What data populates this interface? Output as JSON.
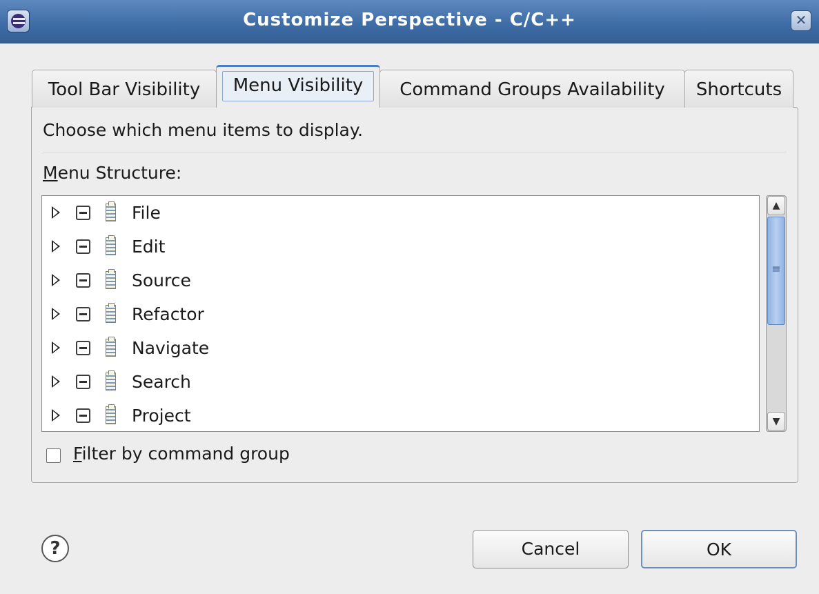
{
  "window": {
    "title": "Customize Perspective - C/C++",
    "close_glyph": "✕"
  },
  "tabs": [
    {
      "label": "Tool Bar Visibility",
      "active": false
    },
    {
      "label": "Menu Visibility",
      "active": true
    },
    {
      "label": "Command Groups Availability",
      "active": false
    },
    {
      "label": "Shortcuts",
      "active": false
    }
  ],
  "panel": {
    "description": "Choose which menu items to display.",
    "menu_structure_mnemonic": "M",
    "menu_structure_rest": "enu Structure:",
    "tree_items": [
      {
        "label": "File"
      },
      {
        "label": "Edit"
      },
      {
        "label": "Source"
      },
      {
        "label": "Refactor"
      },
      {
        "label": "Navigate"
      },
      {
        "label": "Search"
      },
      {
        "label": "Project"
      }
    ],
    "filter": {
      "mnemonic": "F",
      "rest": "ilter by command group",
      "checked": false
    }
  },
  "footer": {
    "help_glyph": "?",
    "cancel_label": "Cancel",
    "ok_label": "OK"
  },
  "colors": {
    "title_bar": "#3f6da6",
    "accent": "#4a7ec1",
    "background": "#ededed"
  }
}
